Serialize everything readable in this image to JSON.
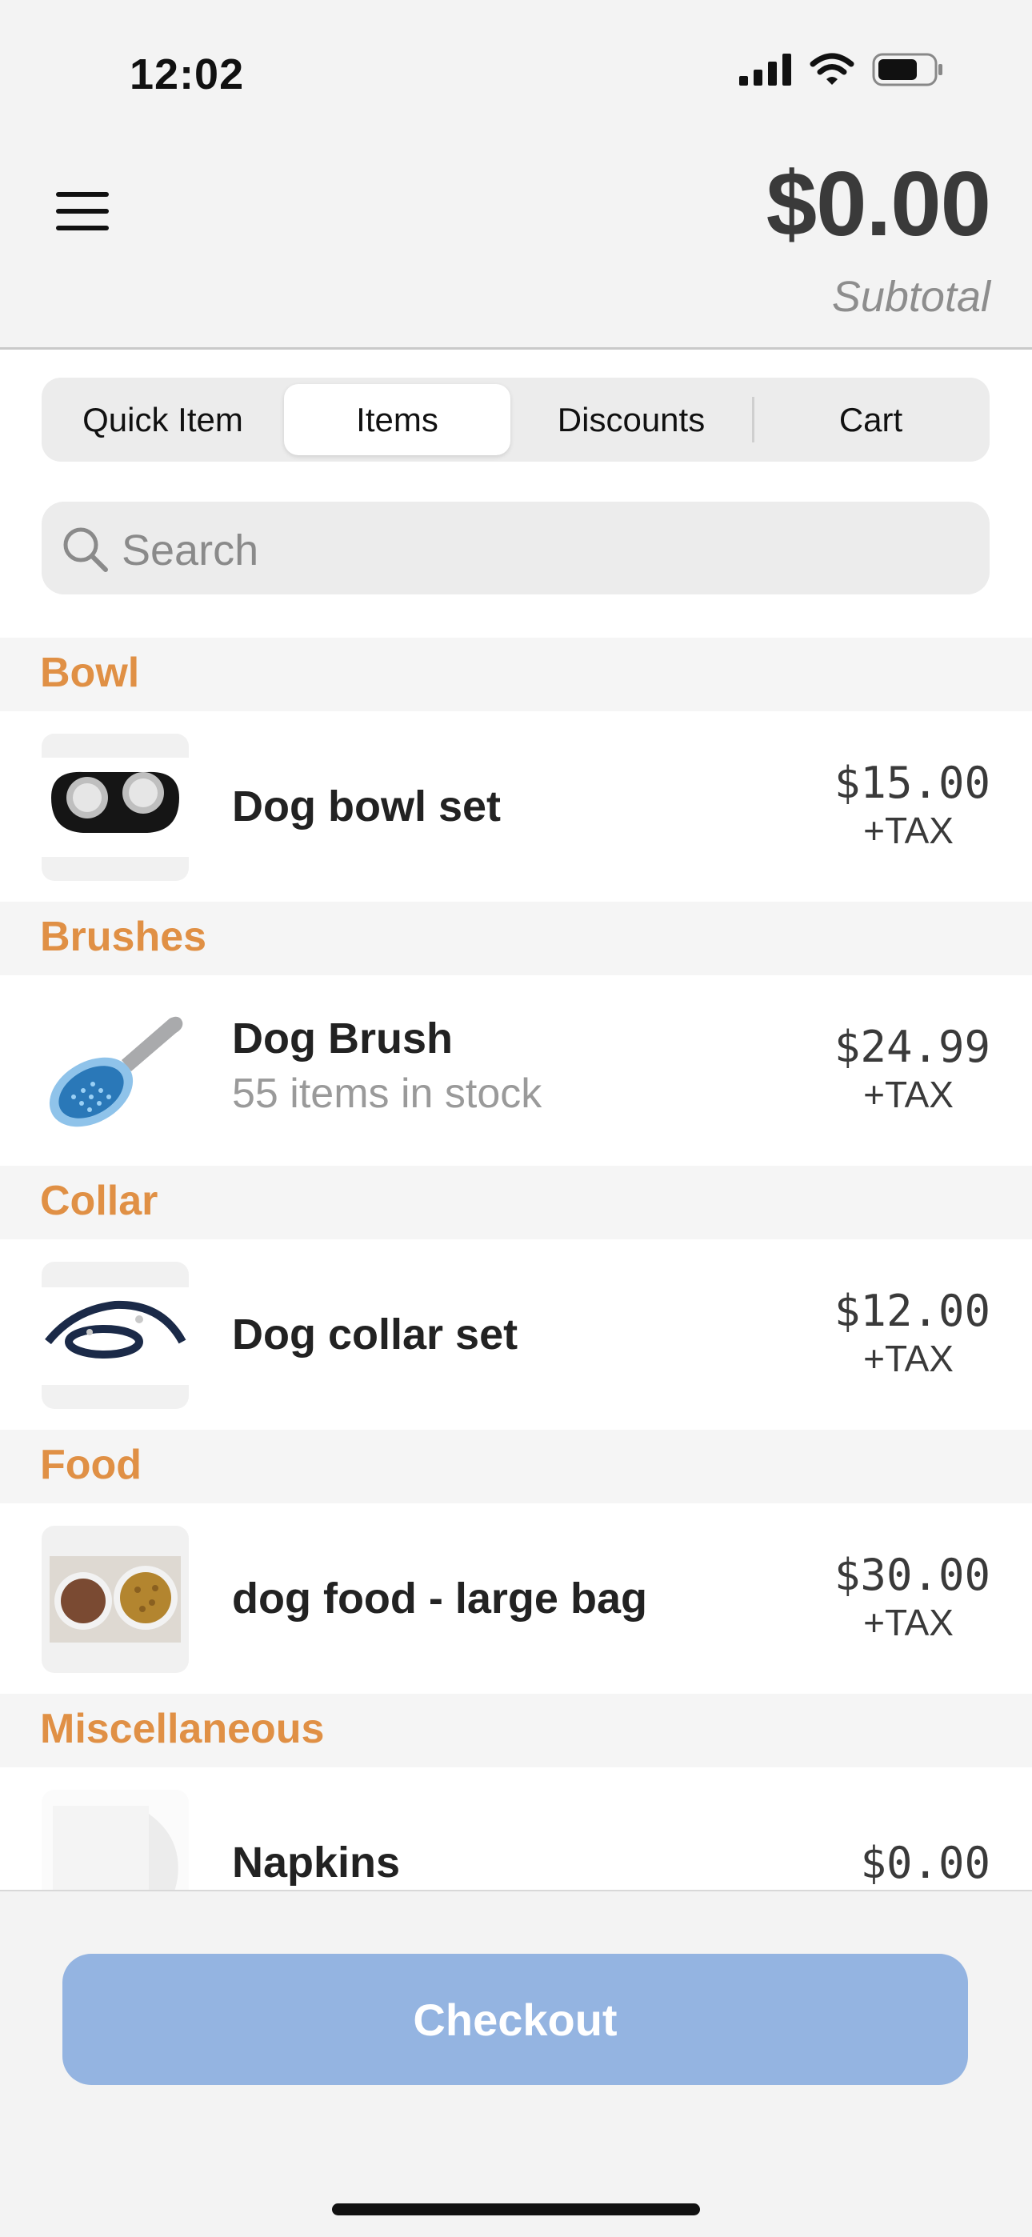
{
  "status_bar": {
    "time": "12:02"
  },
  "header": {
    "amount": "$0.00",
    "subtotal_label": "Subtotal"
  },
  "tabs": [
    {
      "label": "Quick Item"
    },
    {
      "label": "Items",
      "selected": true
    },
    {
      "label": "Discounts"
    },
    {
      "label": "Cart"
    }
  ],
  "search": {
    "placeholder": "Search"
  },
  "sections": [
    {
      "title": "Bowl",
      "items": [
        {
          "name": "Dog bowl set",
          "price": "$15.00",
          "tax": "+TAX"
        }
      ]
    },
    {
      "title": "Brushes",
      "items": [
        {
          "name": "Dog Brush",
          "stock": "55 items in stock",
          "price": "$24.99",
          "tax": "+TAX"
        }
      ]
    },
    {
      "title": "Collar",
      "items": [
        {
          "name": "Dog collar set",
          "price": "$12.00",
          "tax": "+TAX"
        }
      ]
    },
    {
      "title": "Food",
      "items": [
        {
          "name": "dog food - large bag",
          "price": "$30.00",
          "tax": "+TAX"
        }
      ]
    },
    {
      "title": "Miscellaneous",
      "items": [
        {
          "name": "Napkins",
          "price": "$0.00"
        }
      ]
    }
  ],
  "checkout": {
    "label": "Checkout"
  },
  "colors": {
    "section_accent": "#e09045",
    "checkout_button": "#94b4e1"
  }
}
